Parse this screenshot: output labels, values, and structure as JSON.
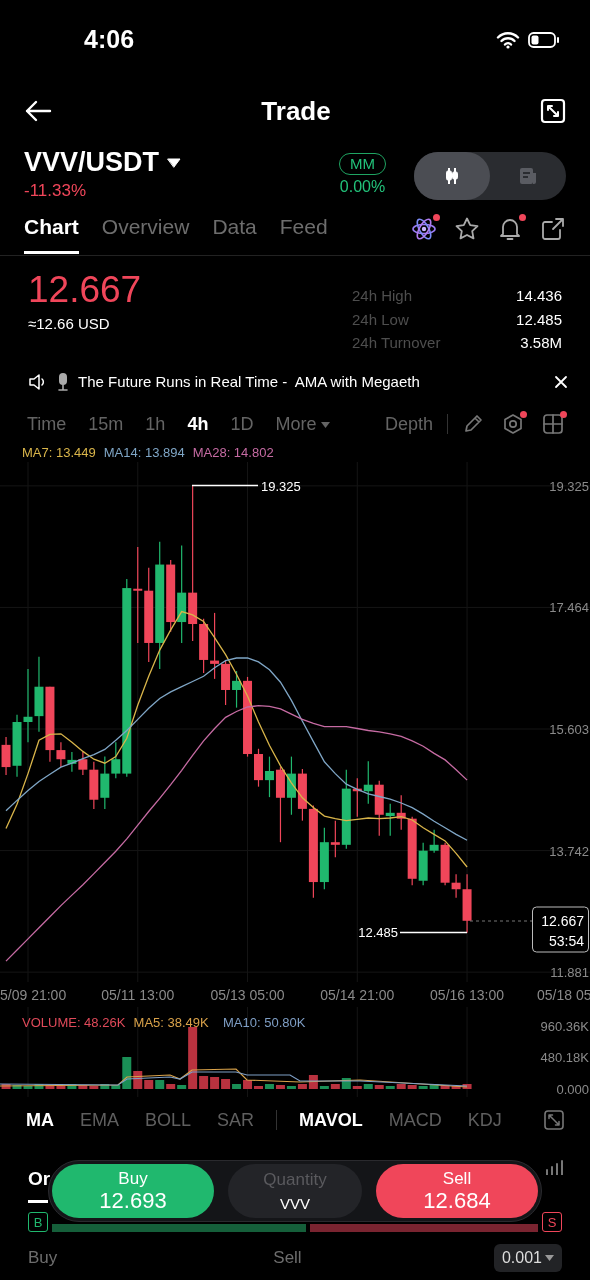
{
  "status_bar": {
    "time": "4:06"
  },
  "header": {
    "title": "Trade"
  },
  "pair": {
    "symbol": "VVV/USDT",
    "change": "-11.33%",
    "badge": "MM",
    "badge_value": "0.00%"
  },
  "view_toggle": [
    {
      "kind": "candles",
      "selected": true
    },
    {
      "kind": "document",
      "selected": false
    }
  ],
  "tabs": [
    {
      "label": "Chart",
      "selected": true
    },
    {
      "label": "Overview",
      "selected": false
    },
    {
      "label": "Data",
      "selected": false
    },
    {
      "label": "Feed",
      "selected": false
    }
  ],
  "tab_icons": [
    {
      "kind": "atom",
      "dot": true
    },
    {
      "kind": "star",
      "dot": false
    },
    {
      "kind": "bell",
      "dot": true
    },
    {
      "kind": "share",
      "dot": false
    }
  ],
  "price": {
    "last": "12.667",
    "usd": "≈12.66 USD"
  },
  "stats": [
    {
      "label": "24h High",
      "value": "14.436"
    },
    {
      "label": "24h Low",
      "value": "12.485"
    },
    {
      "label": "24h Turnover",
      "value": "3.58M"
    }
  ],
  "announcement": {
    "text": "The Future Runs in Real Time -  AMA with Megaeth"
  },
  "intervals": [
    {
      "label": "Time",
      "selected": false
    },
    {
      "label": "15m",
      "selected": false
    },
    {
      "label": "1h",
      "selected": false
    },
    {
      "label": "4h",
      "selected": true
    },
    {
      "label": "1D",
      "selected": false
    },
    {
      "label": "More",
      "selected": false
    }
  ],
  "depth": "Depth",
  "tools": [
    {
      "kind": "pencil",
      "dot": false
    },
    {
      "kind": "hexagon",
      "dot": true
    },
    {
      "kind": "grid",
      "dot": true
    }
  ],
  "chart": {
    "high_label": "19.325",
    "low_label": "12.485",
    "last_price": "12.667",
    "countdown": "53:54",
    "edge_labels": [
      "5/09 21:00",
      "05/18 05"
    ],
    "chart_data": {
      "type": "candlestick",
      "grid": true,
      "ylim": [
        11.73,
        19.69
      ],
      "categories": [
        null,
        null,
        null,
        null,
        null,
        null,
        null,
        null,
        null,
        null,
        null,
        null,
        "05/11 13:00",
        null,
        null,
        null,
        null,
        null,
        null,
        null,
        null,
        null,
        "05/13 05:00",
        null,
        null,
        null,
        null,
        null,
        null,
        null,
        null,
        null,
        "05/14 21:00",
        null,
        null,
        null,
        null,
        null,
        null,
        null,
        null,
        null,
        "05/16 13:00",
        null,
        null,
        null,
        null,
        null,
        null,
        null,
        null,
        null,
        null
      ],
      "yticks": [
        {
          "value": 19.325,
          "label": "19.325"
        },
        {
          "value": 17.464,
          "label": "17.464"
        },
        {
          "value": 15.603,
          "label": "15.603"
        },
        {
          "value": 13.742,
          "label": "13.742"
        },
        {
          "value": 11.881,
          "label": "11.881"
        }
      ],
      "ohlc": [
        [
          15.36,
          15.48,
          14.9,
          15.02
        ],
        [
          15.04,
          15.82,
          14.87,
          15.71
        ],
        [
          15.71,
          16.52,
          15.4,
          15.79
        ],
        [
          15.8,
          16.71,
          15.56,
          16.25
        ],
        [
          16.25,
          16.25,
          15.1,
          15.28
        ],
        [
          15.28,
          15.4,
          15.02,
          15.14
        ],
        [
          15.07,
          15.25,
          14.95,
          15.13
        ],
        [
          15.14,
          15.25,
          14.9,
          14.98
        ],
        [
          14.98,
          15.1,
          14.38,
          14.52
        ],
        [
          14.55,
          15.18,
          14.38,
          14.92
        ],
        [
          14.92,
          15.4,
          14.85,
          15.14
        ],
        [
          14.92,
          17.9,
          14.87,
          17.76
        ],
        [
          17.75,
          18.39,
          16.92,
          17.72
        ],
        [
          17.72,
          18.07,
          16.63,
          16.92
        ],
        [
          16.92,
          18.47,
          16.52,
          18.12
        ],
        [
          18.12,
          18.19,
          17.09,
          17.24
        ],
        [
          17.24,
          18.41,
          16.92,
          17.69
        ],
        [
          17.69,
          19.325,
          16.95,
          17.21
        ],
        [
          17.21,
          17.29,
          16.46,
          16.66
        ],
        [
          16.65,
          17.38,
          16.37,
          16.6
        ],
        [
          16.6,
          16.66,
          15.97,
          16.2
        ],
        [
          16.2,
          16.49,
          15.93,
          16.34
        ],
        [
          16.34,
          16.4,
          15.18,
          15.22
        ],
        [
          15.22,
          15.3,
          14.72,
          14.82
        ],
        [
          14.82,
          15.18,
          14.56,
          14.96
        ],
        [
          14.98,
          15.02,
          13.87,
          14.55
        ],
        [
          14.55,
          15.18,
          14.29,
          14.92
        ],
        [
          14.92,
          14.99,
          14.2,
          14.38
        ],
        [
          14.38,
          14.43,
          13.02,
          13.26
        ],
        [
          13.26,
          14.09,
          13.15,
          13.87
        ],
        [
          13.87,
          14.2,
          13.64,
          13.83
        ],
        [
          13.83,
          14.98,
          13.77,
          14.69
        ],
        [
          14.69,
          14.85,
          14.26,
          14.65
        ],
        [
          14.65,
          15.11,
          14.46,
          14.75
        ],
        [
          14.75,
          14.81,
          13.97,
          14.29
        ],
        [
          14.27,
          14.46,
          13.97,
          14.32
        ],
        [
          14.32,
          14.59,
          14.06,
          14.23
        ],
        [
          14.23,
          14.26,
          13.21,
          13.31
        ],
        [
          13.28,
          13.86,
          13.21,
          13.74
        ],
        [
          13.74,
          14.06,
          13.71,
          13.83
        ],
        [
          13.83,
          13.86,
          13.21,
          13.25
        ],
        [
          13.25,
          13.38,
          13.02,
          13.15
        ],
        [
          13.15,
          13.38,
          12.485,
          12.667
        ],
        null,
        null,
        null,
        null,
        null,
        null,
        null,
        null,
        null,
        null
      ],
      "series": [
        {
          "name": "MA7: 13.449",
          "type": "line",
          "color": "#d9b54a",
          "values": [
            14.08,
            14.45,
            14.92,
            15.43,
            15.52,
            15.53,
            15.4,
            15.26,
            15.14,
            15.08,
            15.18,
            15.46,
            15.97,
            16.41,
            16.81,
            17.12,
            17.4,
            17.35,
            17.25,
            17,
            16.74,
            16.44,
            16.11,
            15.71,
            15.35,
            15.04,
            14.78,
            14.55,
            14.4,
            14.27,
            14.23,
            14.2,
            14.22,
            14.24,
            14.23,
            14.24,
            14.26,
            14.21,
            14.09,
            13.99,
            13.89,
            13.7,
            13.49,
            null,
            null,
            null,
            null,
            null,
            null,
            null,
            null,
            null,
            null
          ]
        },
        {
          "name": "MA14: 13.894",
          "type": "line",
          "color": "#7fa6c6",
          "values": [
            14.35,
            14.51,
            14.66,
            14.8,
            14.91,
            15.02,
            15.08,
            15.15,
            15.21,
            15.29,
            15.43,
            15.58,
            15.75,
            15.92,
            16.07,
            16.17,
            16.25,
            16.33,
            16.41,
            16.54,
            16.65,
            16.69,
            16.69,
            16.63,
            16.51,
            16.32,
            16.04,
            15.72,
            15.41,
            15.1,
            14.92,
            14.76,
            14.68,
            14.61,
            14.57,
            14.53,
            14.47,
            14.4,
            14.3,
            14.19,
            14.09,
            13.99,
            13.9,
            null,
            null,
            null,
            null,
            null,
            null,
            null,
            null,
            null,
            null
          ]
        },
        {
          "name": "MA28: 14.802",
          "type": "line",
          "color": "#c66ba3",
          "values": [
            12.05,
            12.22,
            12.39,
            12.56,
            12.73,
            12.9,
            13.06,
            13.22,
            13.39,
            13.56,
            13.73,
            13.92,
            14.13,
            14.34,
            14.54,
            14.75,
            14.97,
            15.2,
            15.42,
            15.61,
            15.78,
            15.87,
            15.94,
            15.96,
            15.95,
            15.91,
            15.83,
            15.75,
            15.69,
            15.64,
            15.64,
            15.64,
            15.61,
            15.58,
            15.56,
            15.53,
            15.49,
            15.42,
            15.34,
            15.23,
            15.13,
            14.98,
            14.82,
            null,
            null,
            null,
            null,
            null,
            null,
            null,
            null,
            null,
            null
          ]
        }
      ]
    }
  },
  "volume": {
    "legend": [
      {
        "label": "VOLUME: 48.26K",
        "color": "#e04a5a"
      },
      {
        "label": "MA5: 38.49K",
        "color": "#d9a24a"
      },
      {
        "label": "MA10: 50.80K",
        "color": "#7f9fc6"
      }
    ],
    "y_labels": [
      "960.36K",
      "480.18K",
      "0.000"
    ]
  },
  "main_indicators": [
    {
      "label": "MA",
      "selected": true
    },
    {
      "label": "EMA",
      "selected": false
    },
    {
      "label": "BOLL",
      "selected": false
    },
    {
      "label": "SAR",
      "selected": false
    }
  ],
  "sub_indicators": [
    {
      "label": "MAVOL",
      "selected": true
    },
    {
      "label": "MACD",
      "selected": false
    },
    {
      "label": "KDJ",
      "selected": false
    }
  ],
  "bottom_tabs": [
    {
      "label": "Or",
      "selected": true
    }
  ],
  "order_bar": {
    "buy_label": "Buy",
    "buy_price": "12.693",
    "quantity_placeholder": "Quantity",
    "quantity_unit": "VVV",
    "sell_label": "Sell",
    "sell_price": "12.684"
  },
  "ratio": {
    "buy_badge": "B",
    "sell_badge": "S",
    "level": 0.53
  },
  "book_header": {
    "buy": "Buy",
    "sell": "Sell",
    "precision": "0.001"
  }
}
